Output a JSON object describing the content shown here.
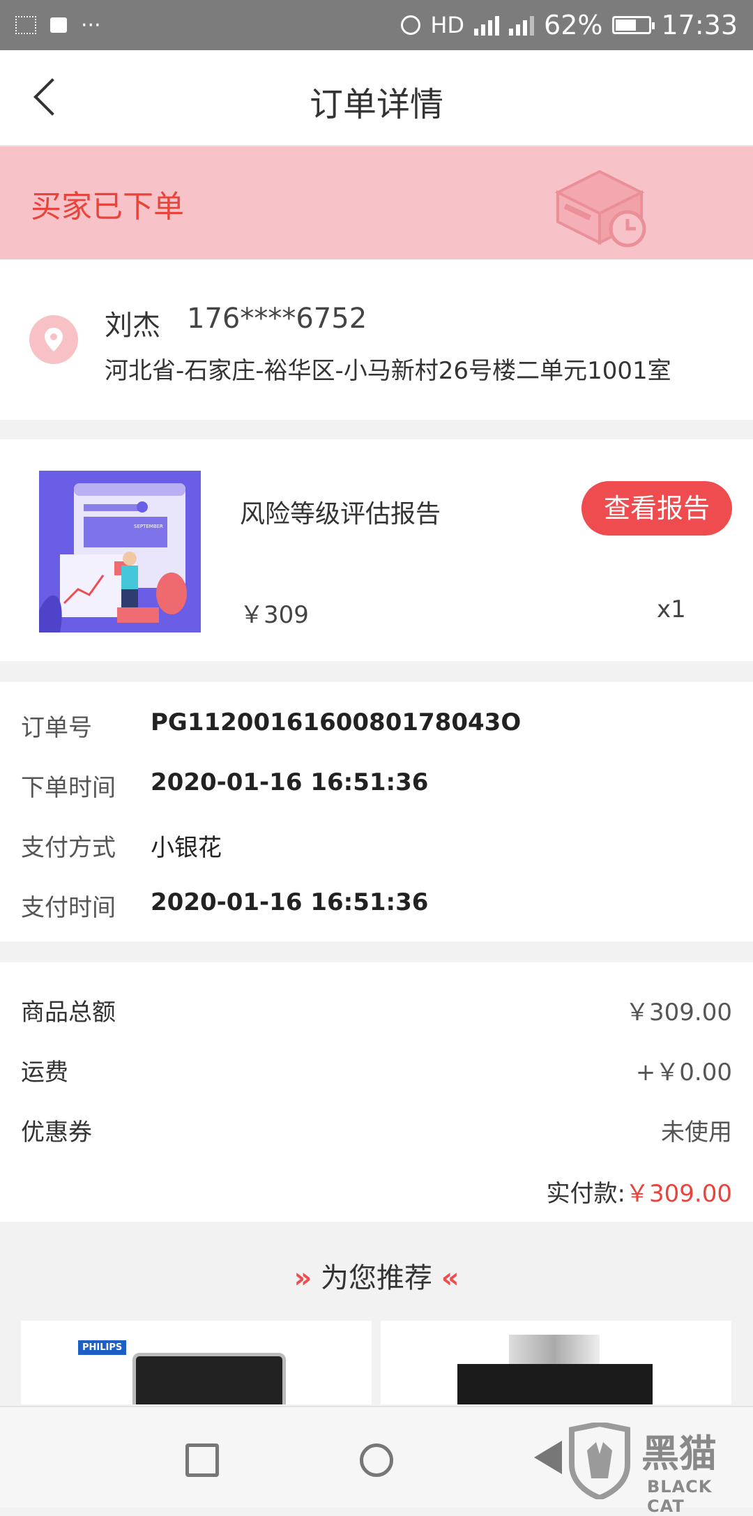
{
  "status_bar": {
    "left_icons": [
      "notification-icon",
      "image-icon",
      "more-icon"
    ],
    "more": "···",
    "network": "HD",
    "battery_level": 62,
    "battery": "62%",
    "time": "17:33"
  },
  "nav": {
    "title": "订单详情",
    "back_icon": "chevron-left-icon"
  },
  "banner": {
    "status": "买家已下单",
    "icon": "package-clock-icon",
    "bg_color": "#f8c3c8",
    "text_color": "#e8443c"
  },
  "address": {
    "icon": "location-pin-icon",
    "name": "刘杰",
    "phone": "176****6752",
    "detail": "河北省-石家庄-裕华区-小马新村26号楼二单元1001室"
  },
  "product": {
    "name": "风险等级评估报告",
    "button": "查看报告",
    "price": "￥309",
    "qty": "x1",
    "image_caption": "SEPTEMBER"
  },
  "order_info": {
    "rows": [
      {
        "label": "订单号",
        "value": "PG1120016160080178043O"
      },
      {
        "label": "下单时间",
        "value": "2020-01-16 16:51:36"
      },
      {
        "label": "支付方式",
        "value": "小银花"
      },
      {
        "label": "支付时间",
        "value": "2020-01-16 16:51:36"
      }
    ]
  },
  "summary": {
    "rows": [
      {
        "label": "商品总额",
        "value": "￥309.00"
      },
      {
        "label": "运费",
        "value": "+￥0.00"
      },
      {
        "label": "优惠券",
        "value": "未使用"
      }
    ],
    "total_label": "实付款:",
    "total_value": "￥309.00",
    "accent_color": "#e8443c"
  },
  "recommend": {
    "title": "为您推荐",
    "left_mark": "»",
    "right_mark": "«",
    "brand": "PHILIPS"
  },
  "watermark": {
    "cn": "黑猫",
    "en": "BLACK CAT"
  }
}
